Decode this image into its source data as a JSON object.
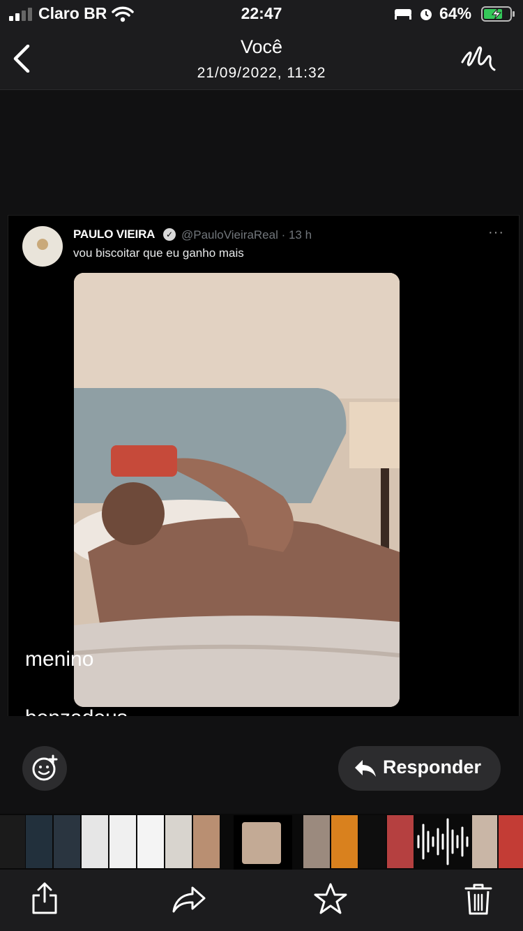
{
  "status_bar": {
    "carrier": "Claro BR",
    "time": "22:47",
    "battery": "64%"
  },
  "header": {
    "title": "Você",
    "subtitle": "21/09/2022, 11:32",
    "back_icon": "chevron-left-icon",
    "markup_icon": "markup-pen-icon"
  },
  "tweet": {
    "name": "PAULO VIEIRA",
    "handle": "@PauloVieiraReal · 13 h",
    "text": "vou biscoitar que eu ganho mais",
    "more": "···"
  },
  "caption": {
    "line1": "menino",
    "line2": "benzadeus"
  },
  "actions": {
    "reply_label": "Responder",
    "emoji_icon": "emoji-reaction-icon",
    "reply_icon": "reply-arrow-icon"
  },
  "toolbar": {
    "share_icon": "share-icon",
    "forward_icon": "forward-icon",
    "star_icon": "star-icon",
    "trash_icon": "trash-icon"
  },
  "colors": {
    "background": "#0f0f10",
    "bar": "#1c1c1e",
    "button": "#2c2c2e",
    "handle": "#71767b"
  }
}
